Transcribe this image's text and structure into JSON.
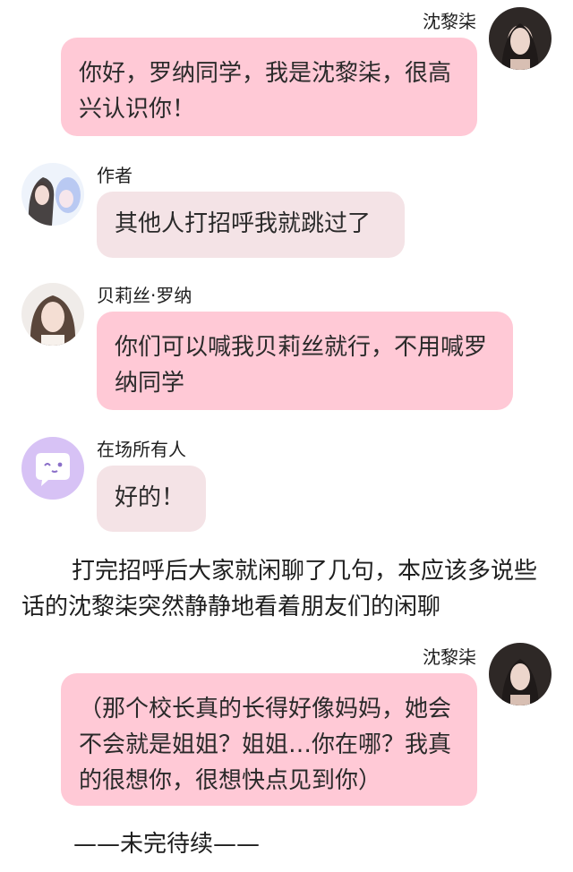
{
  "messages": [
    {
      "sender": "沈黎柒",
      "text": "你好，罗纳同学，我是沈黎柒，很高兴认识你！"
    },
    {
      "sender": "作者",
      "text": "其他人打招呼我就跳过了"
    },
    {
      "sender": "贝莉丝·罗纳",
      "text": "你们可以喊我贝莉丝就行，不用喊罗纳同学"
    },
    {
      "sender": "在场所有人",
      "text": "好的！"
    },
    {
      "sender": "沈黎柒",
      "text": "（那个校长真的长得好像妈妈，她会不会就是姐姐？姐姐…你在哪？我真的很想你，很想快点见到你）"
    }
  ],
  "narration": "打完招呼后大家就闲聊了几句，本应该多说些话的沈黎柒突然静静地看着朋友们的闲聊",
  "footer": "——未完待续——",
  "colors": {
    "bubble_pink": "#ffc9d6",
    "bubble_grey": "#f4e3e6",
    "group_avatar": "#d7c2f5"
  }
}
